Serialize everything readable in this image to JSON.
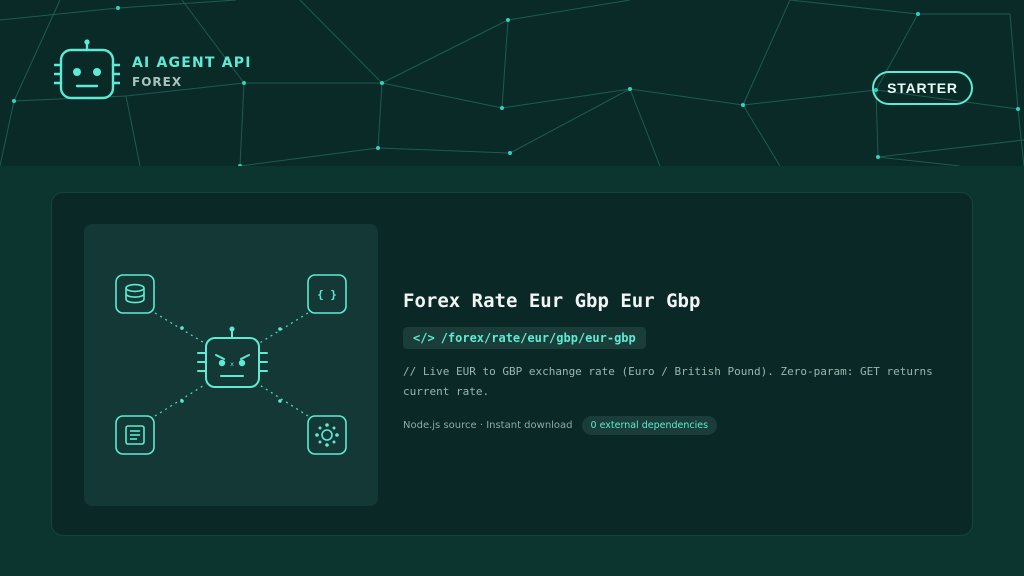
{
  "brand": {
    "title": "AI AGENT API",
    "subtitle": "FOREX",
    "logo_icon": "robot-icon"
  },
  "tier_button": {
    "label": "STARTER"
  },
  "illustration": {
    "center_icon": "robot-icon",
    "nodes": [
      "database-icon",
      "code-braces-icon",
      "document-icon",
      "network-hub-icon"
    ]
  },
  "endpoint": {
    "title": "Forex Rate Eur Gbp Eur Gbp",
    "path_icon": "</>",
    "path": "/forex/rate/eur/gbp/eur-gbp",
    "description": "// Live EUR to GBP exchange rate (Euro / British Pound). Zero-param: GET returns current rate.",
    "meta": "Node.js source · Instant download",
    "dependencies_badge": "0 external dependencies"
  },
  "colors": {
    "accent": "#5eead4",
    "hero_bg": "#0a2a27",
    "page_bg": "#0d3530",
    "card_bg": "#0a2926"
  }
}
